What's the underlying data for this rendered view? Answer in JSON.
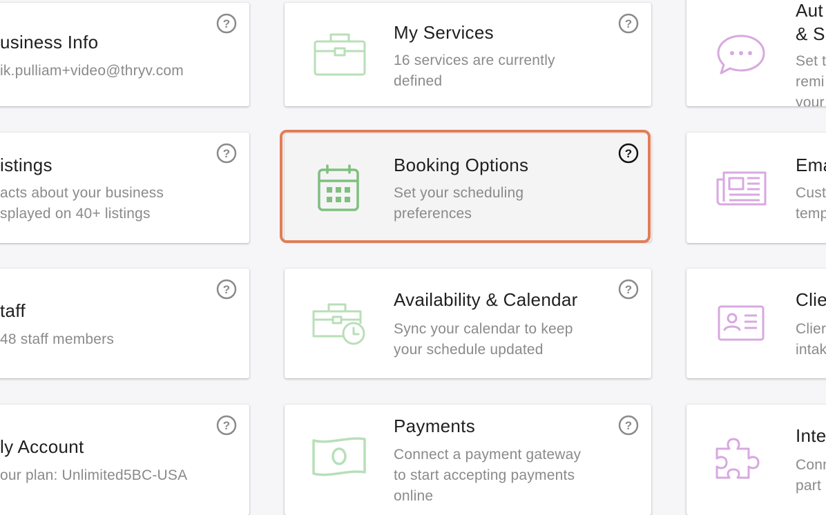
{
  "colors": {
    "highlight": "#e27d57",
    "green_icon": "#a9d7a9",
    "green_icon_active": "#7fbf7f",
    "purple_icon": "#d8a8e0",
    "title_text": "#1f1f1f",
    "desc_text": "#8a8a8a"
  },
  "cards": {
    "business_info": {
      "title": "usiness Info",
      "desc": "ik.pulliam+video@thryv.com",
      "icon": "help-circle-icon"
    },
    "listings": {
      "title": "istings",
      "desc_lines": [
        "acts about your business",
        "splayed on 40+ listings"
      ]
    },
    "staff": {
      "title": "taff",
      "desc": "48 staff members"
    },
    "my_account": {
      "title": "ly Account",
      "desc": "our plan: Unlimited5BC-USA"
    },
    "my_services": {
      "title": "My Services",
      "desc_lines": [
        "16 services are currently",
        "defined"
      ],
      "icon": "briefcase-icon"
    },
    "booking_options": {
      "title": "Booking Options",
      "desc_lines": [
        "Set your scheduling",
        "preferences"
      ],
      "icon": "calendar-icon"
    },
    "availability": {
      "title": "Availability & Calendar",
      "desc_lines": [
        "Sync your calendar to keep",
        "your schedule updated"
      ],
      "icon": "briefcase-clock-icon"
    },
    "payments": {
      "title": "Payments",
      "desc_lines": [
        "Connect a payment gateway",
        "to start accepting payments",
        "online"
      ],
      "icon": "banknote-icon"
    },
    "auto": {
      "title_lines": [
        "Aut",
        "& S"
      ],
      "desc_lines": [
        "Set t",
        "remi",
        "your"
      ],
      "icon": "chat-bubble-icon"
    },
    "email": {
      "title": "Ema",
      "desc_lines": [
        "Cust",
        "temp"
      ],
      "icon": "newspaper-icon"
    },
    "client": {
      "title": "Clie",
      "desc_lines": [
        "Clier",
        "intak"
      ],
      "icon": "id-card-icon"
    },
    "integrations": {
      "title": "Inte",
      "desc_lines": [
        "Conn",
        "part"
      ],
      "icon": "puzzle-icon"
    }
  }
}
